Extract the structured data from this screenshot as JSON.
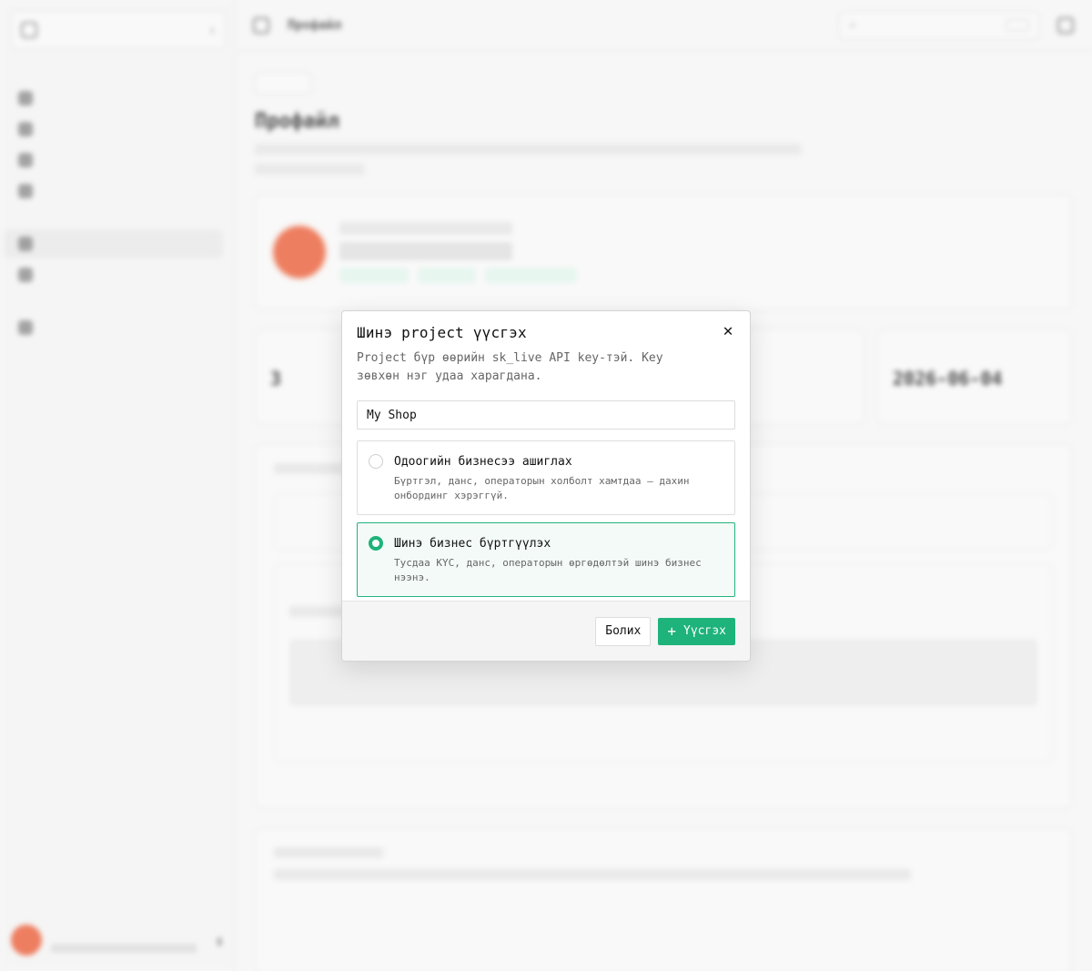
{
  "modal": {
    "title": "Шинэ project үүсгэх",
    "description": "Project бүр өөрийн sk_live API key-тэй. Key зөвхөн нэг удаа харагдана.",
    "name_value": "My Shop",
    "options": [
      {
        "title": "Одоогийн бизнесээ ашиглах",
        "description": "Бүртгэл, данс, операторын холболт хамтдаа — дахин онбординг хэрэггүй.",
        "selected": false
      },
      {
        "title": "Шинэ бизнес бүртгүүлэх",
        "description": "Тусдаа KYC, данс, операторын өргөдөлтэй шинэ бизнес нээнэ.",
        "selected": true
      }
    ],
    "cancel_label": "Болих",
    "create_label": "Үүсгэх",
    "accent_color": "#1db37a"
  },
  "background": {
    "topbar_title": "Профайл",
    "page_title": "Профайл",
    "stat_date": "2026-06-04",
    "stat_count": "3"
  }
}
